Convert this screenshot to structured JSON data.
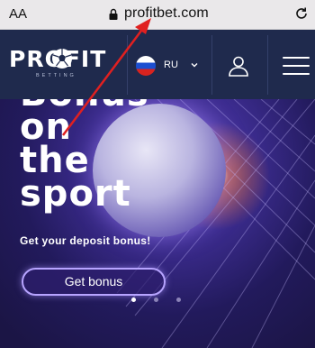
{
  "browser": {
    "text_size_label": "AA",
    "domain": "profitbet.com"
  },
  "header": {
    "logo_text": "PROFIT",
    "logo_subtext": "BETTING",
    "language": "RU"
  },
  "hero": {
    "title_lines": [
      "Bonus",
      "on",
      "the",
      "sport"
    ],
    "subtitle": "Get your deposit bonus!",
    "cta_label": "Get bonus",
    "carousel": {
      "slides": 3,
      "active_index": 0
    }
  },
  "colors": {
    "header_bg": "#1f2a4d",
    "hero_bg": "#2a2060",
    "cta_border": "#b7a4ff",
    "annotation_arrow": "#e02020"
  }
}
